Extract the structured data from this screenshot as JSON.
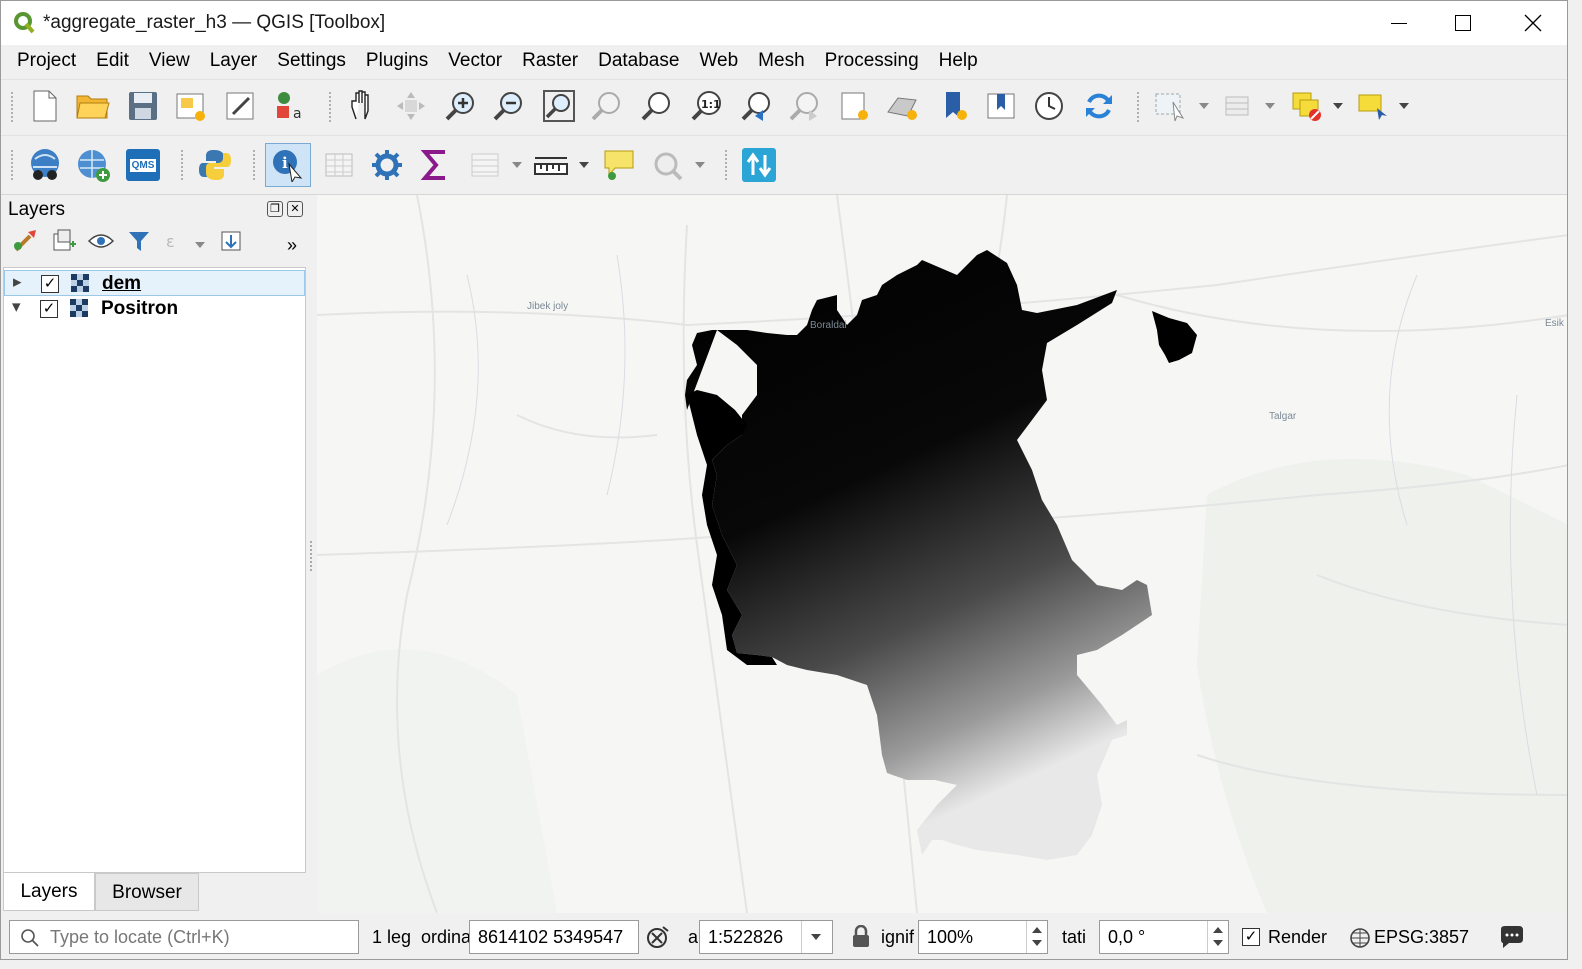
{
  "window": {
    "title": "*aggregate_raster_h3 — QGIS [Toolbox]",
    "minimize_glyph": "—",
    "maximize_glyph": "☐",
    "close_glyph": "✕"
  },
  "menu": [
    "Project",
    "Edit",
    "View",
    "Layer",
    "Settings",
    "Plugins",
    "Vector",
    "Raster",
    "Database",
    "Web",
    "Mesh",
    "Processing",
    "Help"
  ],
  "toolbar1_icons": [
    "new-project-icon",
    "open-project-icon",
    "save-project-icon",
    "new-print-layout-icon",
    "layout-manager-icon",
    "style-manager-icon",
    "pan-icon",
    "pan-to-selection-icon",
    "zoom-in-icon",
    "zoom-out-icon",
    "zoom-full-icon",
    "zoom-to-selection-icon",
    "zoom-to-layer-icon",
    "zoom-native-icon",
    "zoom-last-icon",
    "zoom-next-icon",
    "new-map-view-icon",
    "new-3d-map-view-icon",
    "new-spatial-bookmark-icon",
    "show-bookmarks-icon",
    "temporal-controller-icon",
    "refresh-icon",
    "select-features-icon",
    "attribute-table-icon",
    "deselect-features-icon",
    "annotation-icon"
  ],
  "toolbar2_icons": [
    "metasearch-icon",
    "add-wms-icon",
    "qms-icon",
    "python-console-icon",
    "identify-features-icon",
    "open-field-calculator-icon",
    "processing-toolbox-icon",
    "statistical-summary-icon",
    "open-attribute-table-icon",
    "measure-line-icon",
    "map-tips-icon",
    "spatial-query-icon",
    "vertex-swap-icon"
  ],
  "qms_label": "QMS",
  "layers_panel": {
    "title": "Layers",
    "float_glyph": "❐",
    "close_glyph": "✕",
    "more_glyph": "»",
    "layers": [
      {
        "name": "dem",
        "checked": true,
        "expanded": false,
        "selected": true,
        "arrow": "▸"
      },
      {
        "name": "Positron",
        "checked": true,
        "expanded": true,
        "selected": false,
        "arrow": "▾"
      }
    ],
    "check_glyph": "✓",
    "tabs": [
      "Layers",
      "Browser"
    ]
  },
  "map_labels": [
    "Jibek joly",
    "Boraldai",
    "Talgar",
    "Esik"
  ],
  "status": {
    "locator_placeholder": "Type to locate (Ctrl+K)",
    "legend_text": "1 leg",
    "coord_label": "ordina",
    "coordinate": "8614102  5349547",
    "scale_label": "a",
    "scale": "1:522826",
    "magnifier_label": "ignif",
    "magnifier": "100%",
    "rotation_label": "tati",
    "rotation": "0,0 °",
    "render_label": "Render",
    "render_checked": true,
    "crs": "EPSG:3857"
  }
}
